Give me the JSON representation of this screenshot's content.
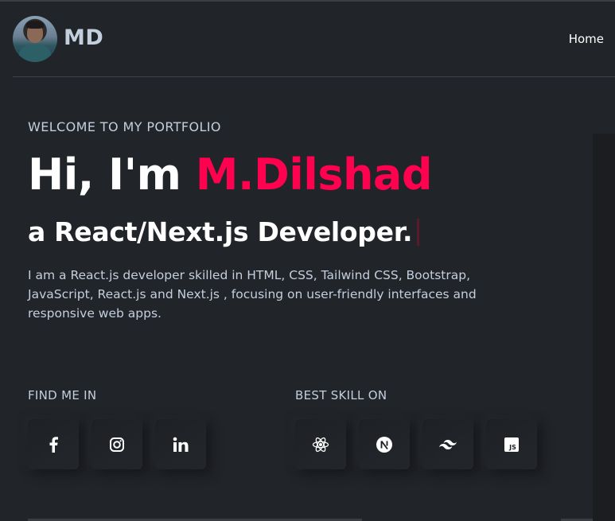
{
  "header": {
    "brand": "MD",
    "nav": [
      {
        "label": "Home"
      }
    ]
  },
  "hero": {
    "welcome": "WELCOME TO MY PORTFOLIO",
    "greeting": "Hi, I'm ",
    "name": "M.Dilshad",
    "role": "a React/Next.js Developer.",
    "bio": "I am a React.js developer skilled in HTML, CSS, Tailwind CSS, Bootstrap, JavaScript, React.js and Next.js , focusing on user-friendly interfaces and responsive web apps."
  },
  "social": {
    "label": "FIND ME IN",
    "icons": [
      "facebook-icon",
      "instagram-icon",
      "linkedin-icon"
    ]
  },
  "skills": {
    "label": "BEST SKILL ON",
    "icons": [
      "react-icon",
      "nextjs-icon",
      "tailwind-icon",
      "javascript-icon"
    ]
  },
  "colors": {
    "background": "#212428",
    "accent": "#ff014f",
    "text": "#c4cfde",
    "heading": "#ffffff"
  }
}
